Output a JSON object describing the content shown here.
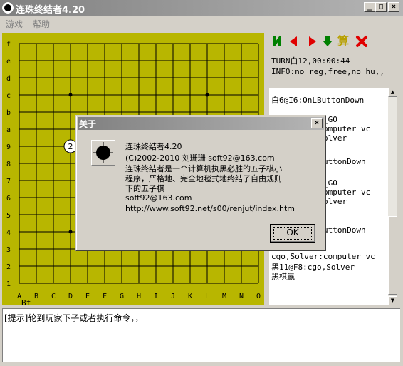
{
  "window": {
    "title": "连珠终结者4.20",
    "buttons": {
      "minimize": "_",
      "maximize": "□",
      "close": "×"
    }
  },
  "menu": {
    "items": [
      "游戏",
      "帮助"
    ]
  },
  "board": {
    "row_labels": [
      "f",
      "e",
      "d",
      "c",
      "b",
      "a",
      "9",
      "8",
      "7",
      "6",
      "5",
      "4",
      "3",
      "2",
      "1"
    ],
    "col_labels": [
      "A",
      "B",
      "C",
      "D",
      "E",
      "F",
      "G",
      "H",
      "I",
      "J",
      "K",
      "L",
      "M",
      "N",
      "O"
    ],
    "below_label": "Bf",
    "stone_move_number": "2"
  },
  "toolbar": {
    "icons": [
      "first-move-icon",
      "back-icon",
      "forward-icon",
      "download-icon",
      "calc-icon",
      "stop-icon"
    ],
    "calc_label": "算",
    "colors": {
      "green": "#008000",
      "red": "#e00000",
      "calc": "#b8a000"
    }
  },
  "status": {
    "turn": "TURN白12,00:00:44",
    "info": "INFO:no reg,free,no hu,,"
  },
  "log": {
    "lines": [
      "白6@I6:OnLButtonDown",
      "_GO",
      "omputer vc",
      "olver",
      "uttonDown",
      "_GO",
      "omputer vc",
      "olver",
      "uttonDown",
      "cgo,Solver:computer vc",
      "黑11@F8:cgo,Solver",
      "黑棋赢"
    ]
  },
  "command": {
    "text": "[提示]轮到玩家下子或者执行命令，，"
  },
  "dialog": {
    "title": "关于",
    "close": "×",
    "lines": [
      "连珠终结者4.20",
      "(C)2002-2010 刘珊珊 soft92@163.com",
      "连珠终结者是一个计算机执黑必胜的五子棋小",
      "程序，严格地、完全地毯式地终结了自由规则",
      "下的五子棋",
      "soft92@163.com",
      "http://www.soft92.net/s00/renjut/index.htm"
    ],
    "ok_label": "OK"
  }
}
